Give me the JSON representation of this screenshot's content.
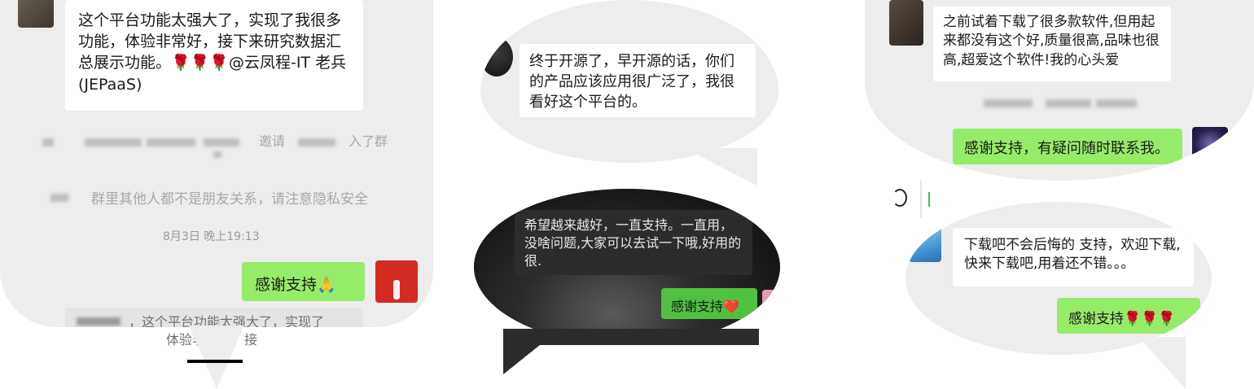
{
  "panel1": {
    "message1": "这个平台功能太强大了，实现了我很多功能，体验非常好，接下来研究数据汇总展示功能。🌹🌹🌹@云凤程-IT 老兵(JEPaaS)",
    "system_invite_fragment1": "邀请",
    "system_invite_fragment2": "入了群",
    "system_privacy": "群里其他人都不是朋友关系，请注意隐私安全",
    "timestamp": "8月3日 晚上19:13",
    "reply": "感谢支持🙏",
    "quote_line1": "，这个平台功能太强大了，实现了",
    "quote_line2": "体验非常好，接"
  },
  "panel2": {
    "message1": "终于开源了，早开源的话，你们的产品应该应用很广泛了，我很看好这个平台的。",
    "message2": "希望越来越好，一直支持。一直用，没啥问题,大家可以去试一下哦,好用的很.",
    "reply": "感谢支持❤️"
  },
  "panel3": {
    "message1": "之前试着下载了很多款软件,但用起来都没有这个好,质量很高,品味也很高,超爱这个软件!我的心头爱",
    "reply1": "感谢支持，有疑问随时联系我。",
    "message2": "下载吧不会后悔的 支持，欢迎下载,快来下载吧,用着还不错。。。",
    "reply2": "感谢支持🌹🌹🌹"
  },
  "colors": {
    "chat_bg": "#ededed",
    "bubble_white": "#ffffff",
    "bubble_green": "#95ec69",
    "dark_bg": "#1c1c1c"
  }
}
